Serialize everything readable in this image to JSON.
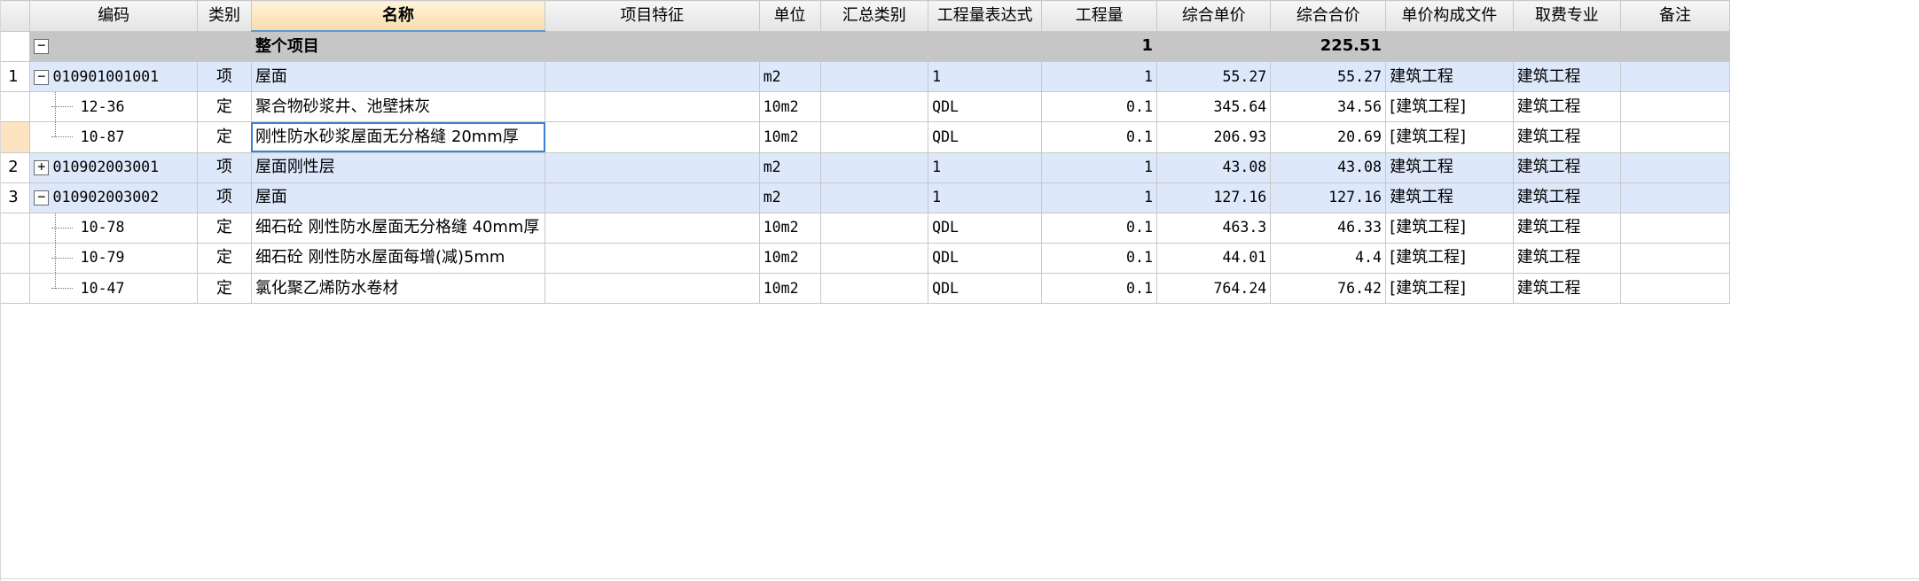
{
  "headers": [
    "",
    "编码",
    "类别",
    "名称",
    "项目特征",
    "单位",
    "汇总类别",
    "工程量表达式",
    "工程量",
    "综合单价",
    "综合合价",
    "单价构成文件",
    "取费专业",
    "备注"
  ],
  "total_row": {
    "toggle": "−",
    "name": "整个项目",
    "quantity": "1",
    "total_price": "225.51"
  },
  "rows": [
    {
      "num": "1",
      "toggle": "−",
      "code": "010901001001",
      "type": "项",
      "name": "屋面",
      "feature": "",
      "unit": "m2",
      "summary": "",
      "expr": "1",
      "qty": "1",
      "unit_price": "55.27",
      "total": "55.27",
      "file": "建筑工程",
      "major": "建筑工程",
      "note": ""
    },
    {
      "num": "",
      "code": "12-36",
      "type": "定",
      "name": "聚合物砂浆井、池壁抹灰",
      "feature": "",
      "unit": "10m2",
      "summary": "",
      "expr": "QDL",
      "qty": "0.1",
      "unit_price": "345.64",
      "total": "34.56",
      "file": "[建筑工程]",
      "major": "建筑工程",
      "note": ""
    },
    {
      "num": "",
      "code": "10-87",
      "type": "定",
      "name": "刚性防水砂浆屋面无分格缝 20mm厚",
      "feature": "",
      "unit": "10m2",
      "summary": "",
      "expr": "QDL",
      "qty": "0.1",
      "unit_price": "206.93",
      "total": "20.69",
      "file": "[建筑工程]",
      "major": "建筑工程",
      "note": ""
    },
    {
      "num": "2",
      "toggle": "+",
      "code": "010902003001",
      "type": "项",
      "name": "屋面刚性层",
      "feature": "",
      "unit": "m2",
      "summary": "",
      "expr": "1",
      "qty": "1",
      "unit_price": "43.08",
      "total": "43.08",
      "file": "建筑工程",
      "major": "建筑工程",
      "note": ""
    },
    {
      "num": "3",
      "toggle": "−",
      "code": "010902003002",
      "type": "项",
      "name": "屋面",
      "feature": "",
      "unit": "m2",
      "summary": "",
      "expr": "1",
      "qty": "1",
      "unit_price": "127.16",
      "total": "127.16",
      "file": "建筑工程",
      "major": "建筑工程",
      "note": ""
    },
    {
      "num": "",
      "code": "10-78",
      "type": "定",
      "name": "细石砼 刚性防水屋面无分格缝 40mm厚",
      "feature": "",
      "unit": "10m2",
      "summary": "",
      "expr": "QDL",
      "qty": "0.1",
      "unit_price": "463.3",
      "total": "46.33",
      "file": "[建筑工程]",
      "major": "建筑工程",
      "note": ""
    },
    {
      "num": "",
      "code": "10-79",
      "type": "定",
      "name": "细石砼 刚性防水屋面每增(减)5mm",
      "feature": "",
      "unit": "10m2",
      "summary": "",
      "expr": "QDL",
      "qty": "0.1",
      "unit_price": "44.01",
      "total": "4.4",
      "file": "[建筑工程]",
      "major": "建筑工程",
      "note": ""
    },
    {
      "num": "",
      "code": "10-47",
      "type": "定",
      "name": "氯化聚乙烯防水卷材",
      "feature": "",
      "unit": "10m2",
      "summary": "",
      "expr": "QDL",
      "qty": "0.1",
      "unit_price": "764.24",
      "total": "76.42",
      "file": "[建筑工程]",
      "major": "建筑工程",
      "note": ""
    }
  ]
}
